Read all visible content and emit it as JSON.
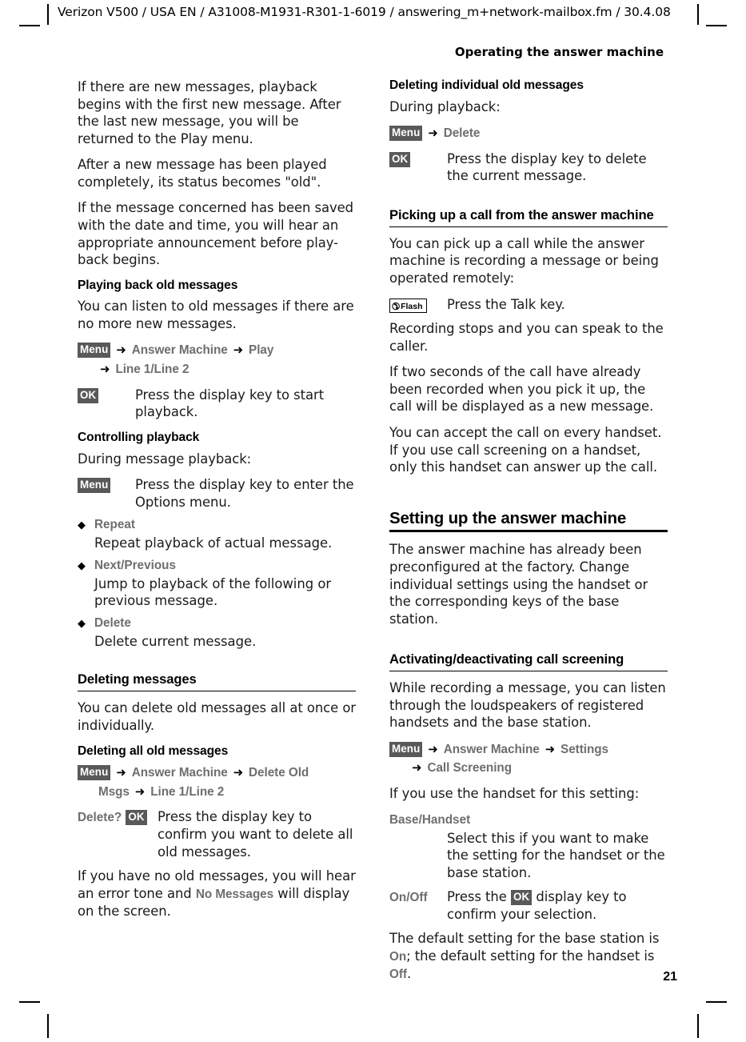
{
  "header": {
    "running_head": "Verizon V500 / USA EN / A31008-M1931-R301-1-6019 / answering_m+network-mailbox.fm / 30.4.08",
    "section_title": "Operating the answer machine"
  },
  "footer": {
    "page_number": "21"
  },
  "ui_colors": {
    "key_chip_bg": "#595959",
    "key_chip_text": "#ffffff",
    "ui_label_gray": "#6e6e6e",
    "body_text": "#1a1a1a",
    "rule": "#000000"
  },
  "keys": {
    "menu": "Menu",
    "ok": "OK",
    "talk": "Flash",
    "talk_icon": "handset-icon",
    "arrow_icon": "right-arrow-icon",
    "bullet_icon": "diamond-bullet-icon"
  },
  "left_column": {
    "para_new_messages": "If there are new messages, playback begins with the first new message. After the last new message, you will be returned to the Play menu.",
    "para_status_old": "After a new message has been played completely, its status becomes \"old\".",
    "para_date_time": "If the message concerned has been saved with the date and time, you will hear an appropriate announcement before play-back begins.",
    "heading_playing_back": "Playing back old messages",
    "para_listen_old": "You can listen to old messages if there are no more new messages.",
    "path_play": {
      "segments": [
        "Answer Machine",
        "Play"
      ],
      "continuation": [
        "Line 1/Line 2"
      ]
    },
    "row_start_playback": {
      "key": "OK",
      "description": "Press the display key to start playback."
    },
    "heading_controlling": "Controlling playback",
    "para_during_playback": "During message playback:",
    "row_options_menu": {
      "key": "Menu",
      "description": "Press the display key to enter the Options menu."
    },
    "options": [
      {
        "label": "Repeat",
        "description": "Repeat playback of actual message."
      },
      {
        "label": "Next/Previous",
        "description": "Jump to playback of the following or previous message."
      },
      {
        "label": "Delete",
        "description": "Delete current message."
      }
    ],
    "heading_deleting_messages": "Deleting messages",
    "para_delete_intro": "You can delete old messages all at once or individually.",
    "heading_delete_all": "Deleting all old messages",
    "path_delete_old": {
      "segments": [
        "Answer Machine",
        "Delete Old"
      ],
      "continuation": [
        "Msgs",
        "Line 1/Line 2"
      ]
    },
    "row_confirm_delete": {
      "prompt": "Delete?",
      "key": "OK",
      "description": "Press the display key to confirm you want to delete all old messages."
    },
    "para_no_messages_pre": "If you have no old messages, you will hear an error tone and ",
    "para_no_messages_ui": "No Messages",
    "para_no_messages_post": " will display on the screen."
  },
  "right_column": {
    "heading_delete_individual": "Deleting individual old messages",
    "para_during_playback": "During playback:",
    "path_delete": {
      "segments": [
        "Delete"
      ]
    },
    "row_delete_current": {
      "key": "OK",
      "description": "Press the display key to delete the current message."
    },
    "heading_picking_up": "Picking up a call from the answer machine",
    "para_pick_up": "You can pick up a call while the answer machine is recording a message or being operated remotely:",
    "row_talk_key": {
      "key": "Flash",
      "description": "Press the Talk key."
    },
    "para_recording_stops": "Recording stops and you can speak to the caller.",
    "para_two_seconds": "If two seconds of the call have already been recorded when you pick it up, the call will be displayed as a new message.",
    "para_accept_call": "You can accept the call on every handset. If you use call screening on a handset, only this handset can answer up the call.",
    "heading_setting_up": "Setting up the answer machine",
    "para_preconfigured": "The answer machine has already been preconfigured at the factory. Change individual settings using the handset or the corresponding keys of the base station.",
    "heading_call_screening": "Activating/deactivating call screening",
    "para_while_recording": "While recording a message, you can listen through the loudspeakers of registered handsets and the base station.",
    "path_call_screening": {
      "segments": [
        "Answer Machine",
        "Settings"
      ],
      "continuation": [
        "Call Screening"
      ]
    },
    "para_if_handset": "If you use the handset for this setting:",
    "label_base_handset": "Base/Handset",
    "para_select_this": "Select this if you want to make the setting for the handset or the base station.",
    "row_on_off": {
      "label": "On/Off",
      "description_pre": "Press the ",
      "key": "OK",
      "description_post": " display key to confirm your selection."
    },
    "para_default_pre": "The default setting for the base station is ",
    "para_default_on": "On",
    "para_default_mid": "; the default setting for the handset is ",
    "para_default_off": "Off",
    "para_default_post": "."
  }
}
